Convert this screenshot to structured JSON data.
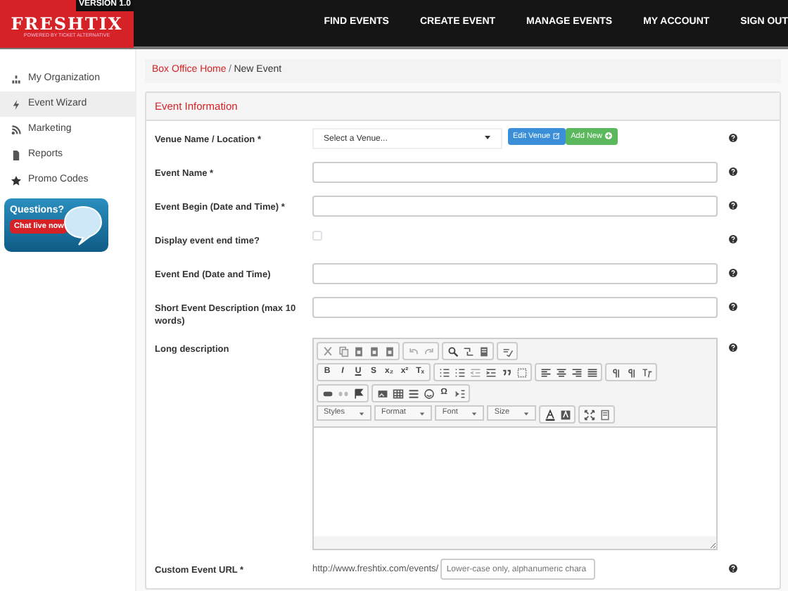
{
  "brand": {
    "version": "VERSION 1.0",
    "name": "FRESHTIX",
    "tagline": "POWERED BY TICKET ALTERNATIVE"
  },
  "nav": [
    "FIND EVENTS",
    "CREATE EVENT",
    "MANAGE EVENTS",
    "MY ACCOUNT",
    "SIGN OUT"
  ],
  "sidebar": {
    "items": [
      {
        "label": "My Organization",
        "selected": false
      },
      {
        "label": "Event Wizard",
        "selected": true
      },
      {
        "label": "Marketing",
        "selected": false
      },
      {
        "label": "Reports",
        "selected": false
      },
      {
        "label": "Promo Codes",
        "selected": false
      }
    ],
    "chat": {
      "title": "Questions?",
      "button": "Chat live now"
    }
  },
  "breadcrumb": {
    "items": [
      "Box Office Home",
      "New Event"
    ],
    "separator": "/"
  },
  "panel": {
    "title": "Event Information",
    "fields": [
      {
        "kind": "select",
        "label": "Venue Name / Location *",
        "value": "Select a Venue...",
        "buttons": [
          "Edit Venue",
          "Add New"
        ]
      },
      {
        "kind": "text",
        "label": "Event Name *"
      },
      {
        "kind": "text",
        "label": "Event Begin (Date and Time) *"
      },
      {
        "kind": "checkbox",
        "label": "Display event end time?",
        "checked": false
      },
      {
        "kind": "text",
        "label": "Event End (Date and Time)"
      },
      {
        "kind": "text",
        "label": "Short Event Description (max 10 words)"
      },
      {
        "kind": "editor",
        "label": "Long description",
        "format_buttons": [
          "B",
          "I",
          "U",
          "S",
          "x₂",
          "x²",
          "Tₓ"
        ],
        "symbol_button": "Ω",
        "dropdowns": [
          "Styles",
          "Format",
          "Font",
          "Size"
        ]
      },
      {
        "kind": "url",
        "label": "Custom Event URL *",
        "prefix": "http://www.freshtix.com/events/",
        "placeholder": "Lower-case only, alphanumeric chara"
      }
    ]
  }
}
